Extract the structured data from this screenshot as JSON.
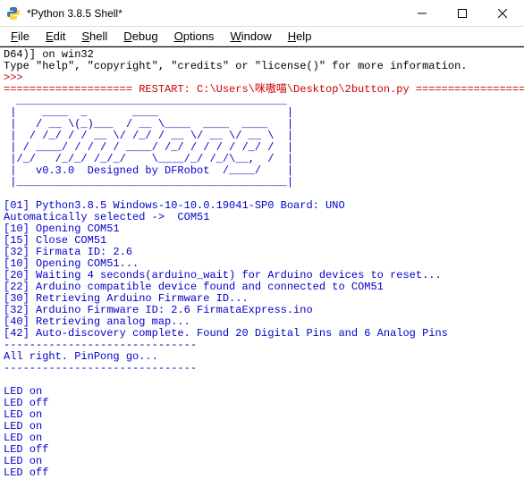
{
  "titlebar": {
    "title": "*Python 3.8.5 Shell*"
  },
  "menu": {
    "file": "File",
    "edit": "Edit",
    "shell": "Shell",
    "debug": "Debug",
    "options": "Options",
    "window": "Window",
    "help": "Help"
  },
  "console": {
    "header1": "D64)] on win32",
    "header2": "Type \"help\", \"copyright\", \"credits\" or \"license()\" for more information.",
    "prompt": ">>> ",
    "restart": "==================== RESTART: C:\\Users\\咪嗷喵\\Desktop\\2button.py ====================",
    "art1": "  __________________________________________",
    "art2": " |    ____  _       ____                    |",
    "art3": " |   / __ \\(_)___  / __ \\____  ____  ____   |",
    "art4": " |  / /_/ / / __ \\/ /_/ / __ \\/ __ \\/ __ \\  |",
    "art5": " | / ____/ / / / / ____/ /_/ / / / / /_/ /  |",
    "art6": " |/_/   /_/_/ /_/_/    \\____/_/ /_/\\__,  /  |",
    "art7": " |   v0.3.0  Designed by DFRobot  /____/    |",
    "art8": " |__________________________________________|",
    "art9": " ",
    "l01": "[01] Python3.8.5 Windows-10-10.0.19041-SP0 Board: UNO",
    "l02": "Automatically selected ->  COM51",
    "l03": "[10] Opening COM51",
    "l04": "[15] Close COM51",
    "l05": "[32] Firmata ID: 2.6",
    "l06": "[10] Opening COM51...",
    "l07": "[20] Waiting 4 seconds(arduino_wait) for Arduino devices to reset...",
    "l08": "[22] Arduino compatible device found and connected to COM51",
    "l09": "[30] Retrieving Arduino Firmware ID...",
    "l10": "[32] Arduino Firmware ID: 2.6 FirmataExpress.ino",
    "l11": "[40] Retrieving analog map...",
    "l12": "[42] Auto-discovery complete. Found 20 Digital Pins and 6 Analog Pins",
    "sep1": "------------------------------",
    "go": "All right. PinPong go...",
    "sep2": "------------------------------",
    "blank": " ",
    "led1": "LED on",
    "led2": "LED off",
    "led3": "LED on",
    "led4": "LED on",
    "led5": "LED on",
    "led6": "LED off",
    "led7": "LED on",
    "led8": "LED off"
  }
}
